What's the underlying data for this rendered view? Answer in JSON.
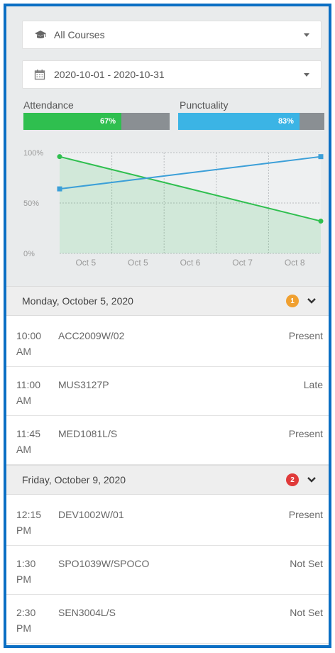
{
  "filters": {
    "course": "All Courses",
    "date_range": "2020-10-01 - 2020-10-31"
  },
  "metrics": {
    "attendance": {
      "label": "Attendance",
      "value_text": "67%",
      "value": 0.67,
      "color": "#2fbf4f"
    },
    "punctuality": {
      "label": "Punctuality",
      "value_text": "83%",
      "value": 0.83,
      "color": "#3bb4e5"
    }
  },
  "chart_data": {
    "type": "line",
    "categories": [
      "Oct 5",
      "Oct 5",
      "Oct 6",
      "Oct 7",
      "Oct 8"
    ],
    "y_ticks": [
      "100%",
      "50%",
      "0%"
    ],
    "ylim": [
      0,
      100
    ],
    "series": [
      {
        "values": [
          96,
          32
        ],
        "color": "#2fbf4f",
        "area": true
      },
      {
        "values": [
          64,
          96
        ],
        "color": "#3b9fd8",
        "area": false
      }
    ]
  },
  "days": [
    {
      "title": "Monday, October 5, 2020",
      "badge": "1",
      "badge_color": "#f0a030",
      "sessions": [
        {
          "time": "10:00 AM",
          "course": "ACC2009W/02",
          "status": "Present"
        },
        {
          "time": "11:00 AM",
          "course": "MUS3127P",
          "status": "Late"
        },
        {
          "time": "11:45 AM",
          "course": "MED1081L/S",
          "status": "Present"
        }
      ]
    },
    {
      "title": "Friday, October 9, 2020",
      "badge": "2",
      "badge_color": "#e03a3a",
      "sessions": [
        {
          "time": "12:15 PM",
          "course": "DEV1002W/01",
          "status": "Present"
        },
        {
          "time": "1:30 PM",
          "course": "SPO1039W/SPOCO",
          "status": "Not Set"
        },
        {
          "time": "2:30 PM",
          "course": "SEN3004L/S",
          "status": "Not Set"
        }
      ]
    }
  ]
}
